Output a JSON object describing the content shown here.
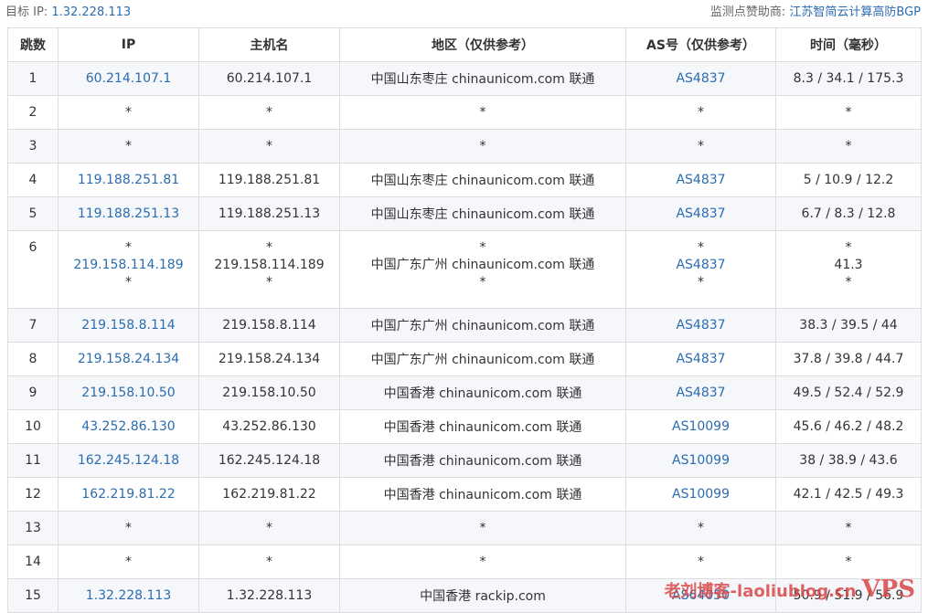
{
  "header": {
    "target_label": "目标 IP:",
    "target_ip": "1.32.228.113",
    "sponsor_label": "监测点赞助商:",
    "sponsor_name": "江苏智简云计算高防BGP"
  },
  "table": {
    "columns": [
      "跳数",
      "IP",
      "主机名",
      "地区（仅供参考）",
      "AS号（仅供参考）",
      "时间（毫秒）"
    ],
    "rows": [
      {
        "hop": "1",
        "ip": "60.214.107.1",
        "host": "60.214.107.1",
        "region": "中国山东枣庄 chinaunicom.com 联通",
        "asn": "AS4837",
        "time": "8.3 / 34.1 / 175.3"
      },
      {
        "hop": "2",
        "ip": "*",
        "host": "*",
        "region": "*",
        "asn": "*",
        "time": "*"
      },
      {
        "hop": "3",
        "ip": "*",
        "host": "*",
        "region": "*",
        "asn": "*",
        "time": "*"
      },
      {
        "hop": "4",
        "ip": "119.188.251.81",
        "host": "119.188.251.81",
        "region": "中国山东枣庄 chinaunicom.com 联通",
        "asn": "AS4837",
        "time": "5 / 10.9 / 12.2"
      },
      {
        "hop": "5",
        "ip": "119.188.251.13",
        "host": "119.188.251.13",
        "region": "中国山东枣庄 chinaunicom.com 联通",
        "asn": "AS4837",
        "time": "6.7 / 8.3 / 12.8"
      },
      {
        "hop": "6",
        "multi": true,
        "ip": [
          "*",
          "219.158.114.189",
          "*"
        ],
        "host": [
          "*",
          "219.158.114.189",
          "*"
        ],
        "region": [
          "*",
          "中国广东广州 chinaunicom.com 联通",
          "*"
        ],
        "asn": [
          "*",
          "AS4837",
          "*"
        ],
        "time": [
          "*",
          "41.3",
          "*"
        ]
      },
      {
        "hop": "7",
        "ip": "219.158.8.114",
        "host": "219.158.8.114",
        "region": "中国广东广州 chinaunicom.com 联通",
        "asn": "AS4837",
        "time": "38.3 / 39.5 / 44"
      },
      {
        "hop": "8",
        "ip": "219.158.24.134",
        "host": "219.158.24.134",
        "region": "中国广东广州 chinaunicom.com 联通",
        "asn": "AS4837",
        "time": "37.8 / 39.8 / 44.7"
      },
      {
        "hop": "9",
        "ip": "219.158.10.50",
        "host": "219.158.10.50",
        "region": "中国香港 chinaunicom.com 联通",
        "asn": "AS4837",
        "time": "49.5 / 52.4 / 52.9"
      },
      {
        "hop": "10",
        "ip": "43.252.86.130",
        "host": "43.252.86.130",
        "region": "中国香港 chinaunicom.com 联通",
        "asn": "AS10099",
        "time": "45.6 / 46.2 / 48.2"
      },
      {
        "hop": "11",
        "ip": "162.245.124.18",
        "host": "162.245.124.18",
        "region": "中国香港 chinaunicom.com 联通",
        "asn": "AS10099",
        "time": "38 / 38.9 / 43.6"
      },
      {
        "hop": "12",
        "ip": "162.219.81.22",
        "host": "162.219.81.22",
        "region": "中国香港 chinaunicom.com 联通",
        "asn": "AS10099",
        "time": "42.1 / 42.5 / 49.3"
      },
      {
        "hop": "13",
        "ip": "*",
        "host": "*",
        "region": "*",
        "asn": "*",
        "time": "*"
      },
      {
        "hop": "14",
        "ip": "*",
        "host": "*",
        "region": "*",
        "asn": "*",
        "time": "*"
      },
      {
        "hop": "15",
        "ip": "1.32.228.113",
        "host": "1.32.228.113",
        "region": "中国香港 rackip.com",
        "asn": "AS64050",
        "time": "50.9 / 51.9 / 56.9"
      }
    ]
  },
  "watermark": {
    "text": "老刘博客-laoliublog.cn",
    "brand": "VPS"
  }
}
